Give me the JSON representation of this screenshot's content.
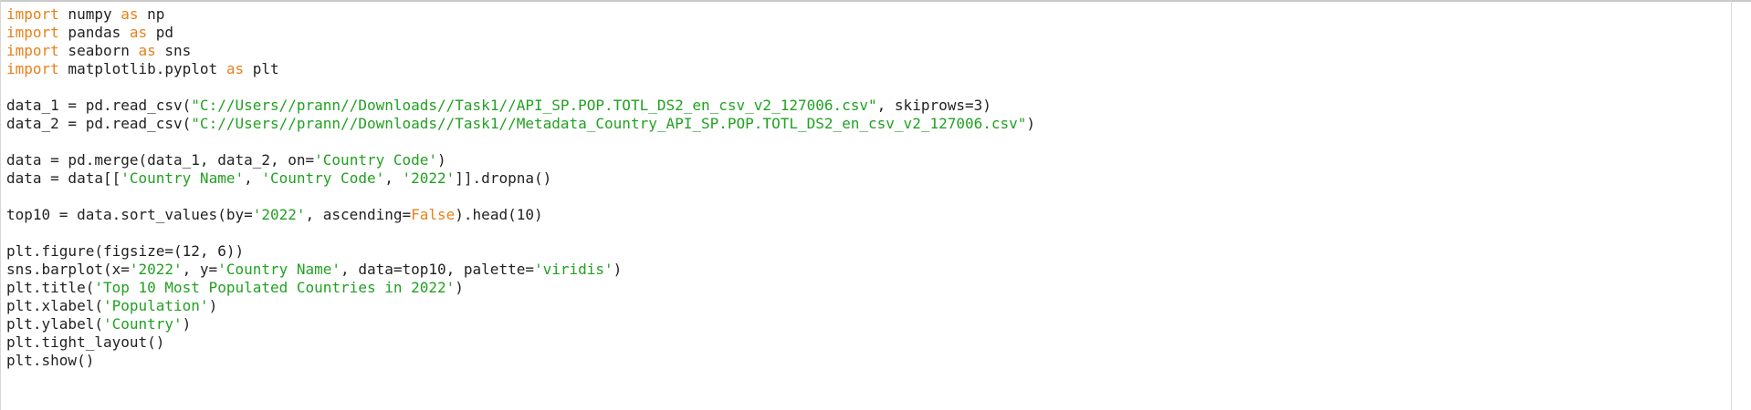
{
  "colors": {
    "keyword": "#e8801a",
    "string": "#22a122",
    "text": "#222222",
    "background": "#ffffff"
  },
  "lines": [
    [
      {
        "t": "kw",
        "v": "import"
      },
      {
        "t": "plain",
        "v": " numpy "
      },
      {
        "t": "kw",
        "v": "as"
      },
      {
        "t": "plain",
        "v": " np"
      }
    ],
    [
      {
        "t": "kw",
        "v": "import"
      },
      {
        "t": "plain",
        "v": " pandas "
      },
      {
        "t": "kw",
        "v": "as"
      },
      {
        "t": "plain",
        "v": " pd"
      }
    ],
    [
      {
        "t": "kw",
        "v": "import"
      },
      {
        "t": "plain",
        "v": " seaborn "
      },
      {
        "t": "kw",
        "v": "as"
      },
      {
        "t": "plain",
        "v": " sns"
      }
    ],
    [
      {
        "t": "kw",
        "v": "import"
      },
      {
        "t": "plain",
        "v": " matplotlib.pyplot "
      },
      {
        "t": "kw",
        "v": "as"
      },
      {
        "t": "plain",
        "v": " plt"
      }
    ],
    [],
    [
      {
        "t": "plain",
        "v": "data_1 = pd.read_csv("
      },
      {
        "t": "str",
        "v": "\"C://Users//prann//Downloads//Task1//API_SP.POP.TOTL_DS2_en_csv_v2_127006.csv\""
      },
      {
        "t": "plain",
        "v": ", skiprows=3)"
      }
    ],
    [
      {
        "t": "plain",
        "v": "data_2 = pd.read_csv("
      },
      {
        "t": "str",
        "v": "\"C://Users//prann//Downloads//Task1//Metadata_Country_API_SP.POP.TOTL_DS2_en_csv_v2_127006.csv\""
      },
      {
        "t": "plain",
        "v": ")"
      }
    ],
    [],
    [
      {
        "t": "plain",
        "v": "data = pd.merge(data_1, data_2, on="
      },
      {
        "t": "str",
        "v": "'Country Code'"
      },
      {
        "t": "plain",
        "v": ")"
      }
    ],
    [
      {
        "t": "plain",
        "v": "data = data[["
      },
      {
        "t": "str",
        "v": "'Country Name'"
      },
      {
        "t": "plain",
        "v": ", "
      },
      {
        "t": "str",
        "v": "'Country Code'"
      },
      {
        "t": "plain",
        "v": ", "
      },
      {
        "t": "str",
        "v": "'2022'"
      },
      {
        "t": "plain",
        "v": "]].dropna()"
      }
    ],
    [],
    [
      {
        "t": "plain",
        "v": "top10 = data.sort_values(by="
      },
      {
        "t": "str",
        "v": "'2022'"
      },
      {
        "t": "plain",
        "v": ", ascending="
      },
      {
        "t": "kw",
        "v": "False"
      },
      {
        "t": "plain",
        "v": ").head(10)"
      }
    ],
    [],
    [
      {
        "t": "plain",
        "v": "plt.figure(figsize=(12, 6))"
      }
    ],
    [
      {
        "t": "plain",
        "v": "sns.barplot(x="
      },
      {
        "t": "str",
        "v": "'2022'"
      },
      {
        "t": "plain",
        "v": ", y="
      },
      {
        "t": "str",
        "v": "'Country Name'"
      },
      {
        "t": "plain",
        "v": ", data=top10, palette="
      },
      {
        "t": "str",
        "v": "'viridis'"
      },
      {
        "t": "plain",
        "v": ")"
      }
    ],
    [
      {
        "t": "plain",
        "v": "plt.title("
      },
      {
        "t": "str",
        "v": "'Top 10 Most Populated Countries in 2022'"
      },
      {
        "t": "plain",
        "v": ")"
      }
    ],
    [
      {
        "t": "plain",
        "v": "plt.xlabel("
      },
      {
        "t": "str",
        "v": "'Population'"
      },
      {
        "t": "plain",
        "v": ")"
      }
    ],
    [
      {
        "t": "plain",
        "v": "plt.ylabel("
      },
      {
        "t": "str",
        "v": "'Country'"
      },
      {
        "t": "plain",
        "v": ")"
      }
    ],
    [
      {
        "t": "plain",
        "v": "plt.tight_layout()"
      }
    ],
    [
      {
        "t": "plain",
        "v": "plt.show()"
      }
    ]
  ]
}
